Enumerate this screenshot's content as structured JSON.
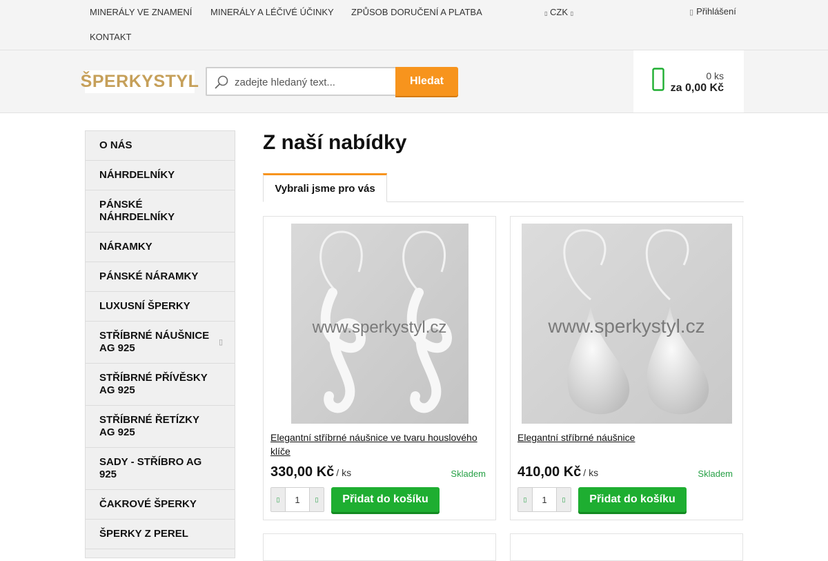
{
  "topnav": {
    "items": [
      "Minerály ve znamení",
      "Minerály a léčivé účinky",
      "Způsob doručení a platba",
      "Kontakt"
    ],
    "currency": "CZK",
    "login": "Přihlášení"
  },
  "header": {
    "logo_text": "ŠPERKYSTYL",
    "search_placeholder": "zadejte hledaný text...",
    "search_button": "Hledat",
    "cart_qty": "0 ks",
    "cart_total": "za 0,00 Kč"
  },
  "sidebar": {
    "items": [
      {
        "label": "O nás"
      },
      {
        "label": "Náhrdelníky"
      },
      {
        "label": "Pánské náhrdelníky"
      },
      {
        "label": "Náramky"
      },
      {
        "label": "Pánské náramky"
      },
      {
        "label": "Luxusní šperky"
      },
      {
        "label": "Stříbrné náušnice Ag 925"
      },
      {
        "label": "Stříbrné přívěsky Ag 925"
      },
      {
        "label": "Stříbrné řetízky Ag 925"
      },
      {
        "label": "Sady - stříbro Ag 925"
      },
      {
        "label": "Čakrové šperky"
      },
      {
        "label": "Šperky z perel"
      }
    ]
  },
  "main": {
    "title": "Z naší nabídky",
    "tab": "Vybrali jsme pro vás",
    "products": [
      {
        "name": "Elegantní stříbrné náušnice ve tvaru houslového klíče",
        "price": "330,00 Kč",
        "unit": "/ ks",
        "stock": "Skladem",
        "qty": "1",
        "add_label": "Přidat do košíku",
        "watermark": "www.sperkystyl.cz"
      },
      {
        "name": "Elegantní stříbrné náušnice",
        "price": "410,00 Kč",
        "unit": "/ ks",
        "stock": "Skladem",
        "qty": "1",
        "add_label": "Přidat do košíku",
        "watermark": "www.sperkystyl.cz"
      }
    ]
  },
  "colors": {
    "accent_orange": "#f7941d",
    "add_green": "#1eae31",
    "stock_green": "#27a046",
    "logo_gold": "#c6a05a"
  }
}
